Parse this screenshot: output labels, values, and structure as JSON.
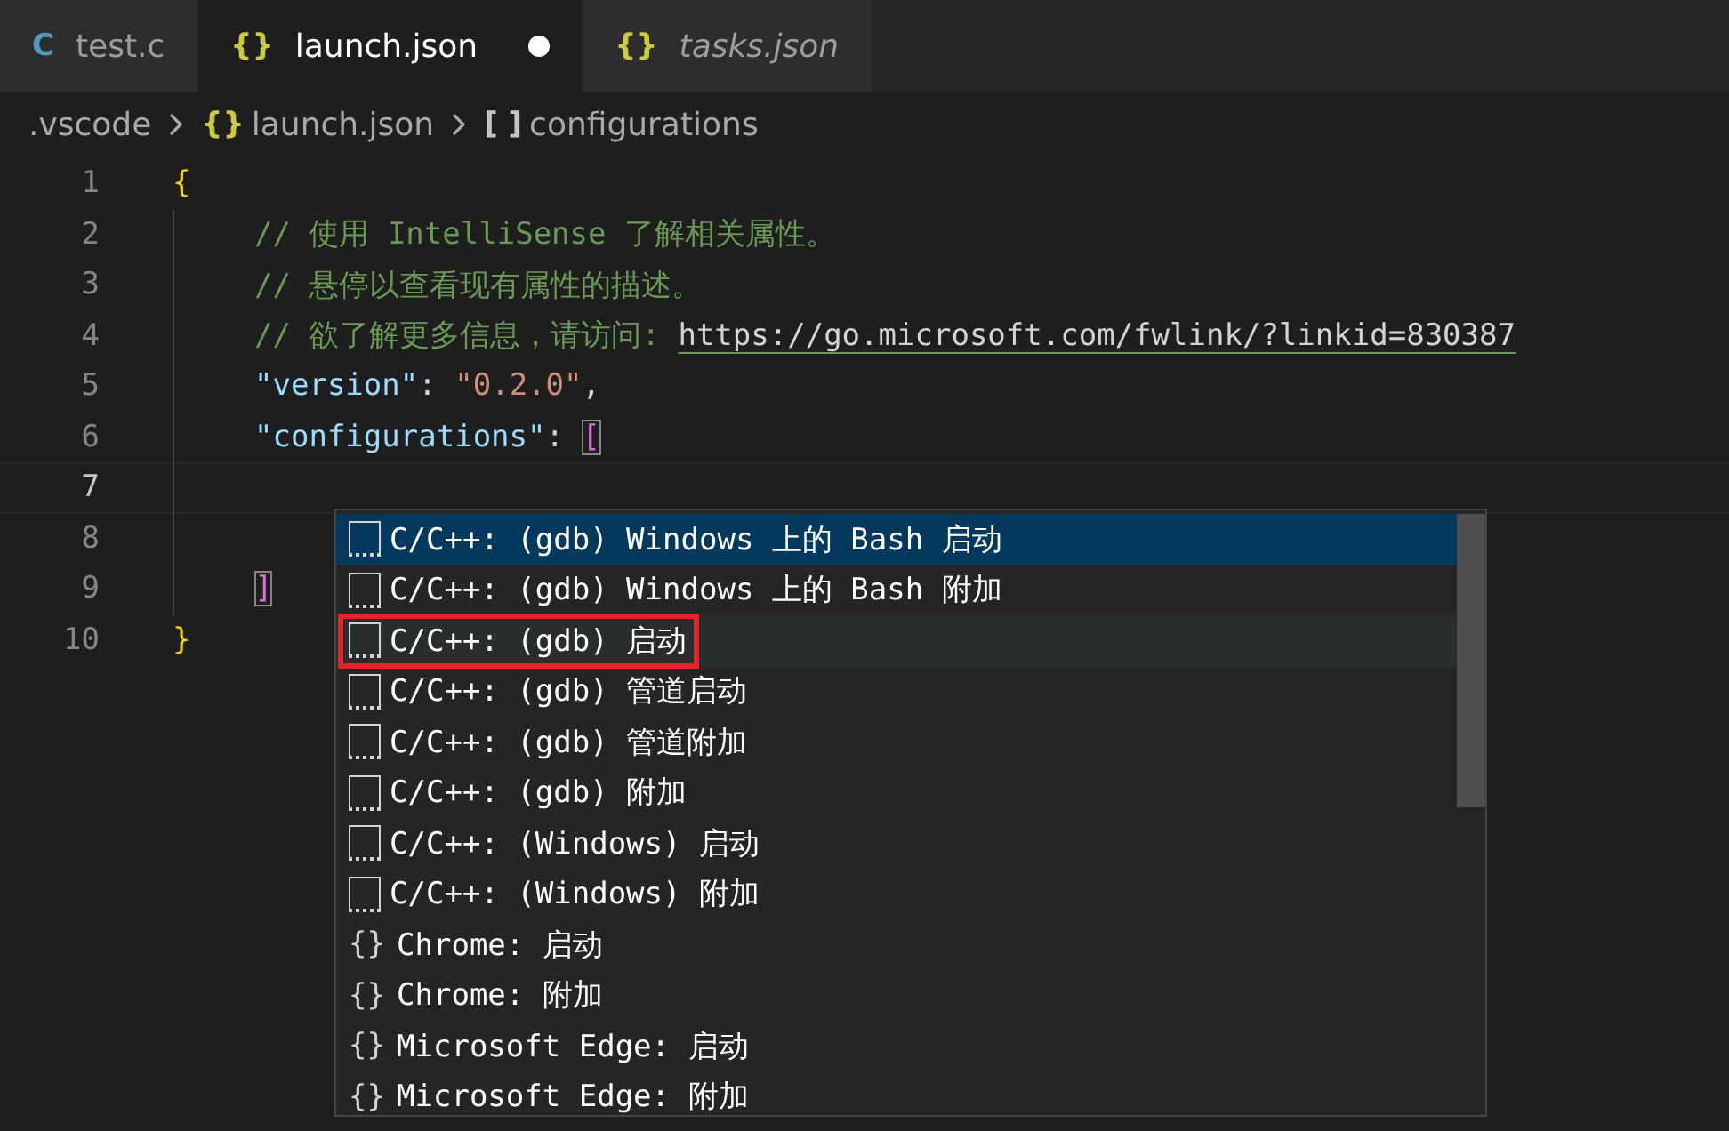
{
  "tabs": [
    {
      "label": "test.c",
      "icon": "C",
      "color": "#519aba",
      "selected": false,
      "modified": false,
      "preview": false
    },
    {
      "label": "launch.json",
      "icon": "{}",
      "color": "#cbcb41",
      "selected": true,
      "modified": true,
      "preview": false
    },
    {
      "label": "tasks.json",
      "icon": "{}",
      "color": "#cbcb41",
      "selected": false,
      "modified": false,
      "preview": true
    }
  ],
  "breadcrumbs": [
    {
      "label": ".vscode"
    },
    {
      "label": "launch.json",
      "icon": "{}",
      "color": "#cbcb41"
    },
    {
      "label": "configurations",
      "icon": "[ ]",
      "color": "#c5c5c5"
    }
  ],
  "lines": [
    {
      "number": "1",
      "tokens": [
        {
          "text": "{",
          "kind": "brace"
        }
      ],
      "children": [
        {
          "number": "2",
          "tokens": [
            {
              "text": "// 使用 IntelliSense 了解相关属性。",
              "kind": "comment"
            }
          ]
        },
        {
          "number": "3",
          "tokens": [
            {
              "text": "// 悬停以查看现有属性的描述。",
              "kind": "comment"
            }
          ]
        },
        {
          "number": "4",
          "tokens": [
            {
              "text": "// 欲了解更多信息，请访问: ",
              "kind": "comment"
            },
            {
              "text": "https://go.microsoft.com/fwlink/?linkid=830387",
              "kind": "link"
            }
          ]
        },
        {
          "number": "5",
          "tokens": [
            {
              "text": "\"version\"",
              "kind": "key"
            },
            {
              "text": ": ",
              "kind": "punct"
            },
            {
              "text": "\"0.2.0\"",
              "kind": "string"
            },
            {
              "text": ",",
              "kind": "punct"
            }
          ]
        },
        {
          "number": "6",
          "tokens": [
            {
              "text": "\"configurations\"",
              "kind": "key"
            },
            {
              "text": ": ",
              "kind": "punct"
            },
            {
              "text": "[",
              "kind": "bracket",
              "matched": true
            }
          ]
        },
        {
          "number": "7",
          "current": true
        },
        {
          "number": "8"
        },
        {
          "number": "9",
          "tokens": [
            {
              "text": "]",
              "kind": "bracket",
              "matched": true
            }
          ]
        }
      ]
    },
    {
      "number": "10",
      "tokens": [
        {
          "text": "}",
          "kind": "brace"
        }
      ]
    }
  ],
  "suggestions": [
    {
      "label": "C/C++: (gdb) Windows 上的 Bash 启动",
      "kind": "snippet",
      "selected": true,
      "outlined": false
    },
    {
      "label": "C/C++: (gdb) Windows 上的 Bash 附加",
      "kind": "snippet",
      "selected": false,
      "outlined": false
    },
    {
      "label": "C/C++: (gdb) 启动",
      "kind": "snippet",
      "selected": false,
      "outlined": true
    },
    {
      "label": "C/C++: (gdb) 管道启动",
      "kind": "snippet",
      "selected": false,
      "outlined": false
    },
    {
      "label": "C/C++: (gdb) 管道附加",
      "kind": "snippet",
      "selected": false,
      "outlined": false
    },
    {
      "label": "C/C++: (gdb) 附加",
      "kind": "snippet",
      "selected": false,
      "outlined": false
    },
    {
      "label": "C/C++: (Windows) 启动",
      "kind": "snippet",
      "selected": false,
      "outlined": false
    },
    {
      "label": "C/C++: (Windows) 附加",
      "kind": "snippet",
      "selected": false,
      "outlined": false
    },
    {
      "label": "Chrome: 启动",
      "kind": "module",
      "icon": "{}",
      "selected": false,
      "outlined": false
    },
    {
      "label": "Chrome: 附加",
      "kind": "module",
      "icon": "{}",
      "selected": false,
      "outlined": false
    },
    {
      "label": "Microsoft Edge: 启动",
      "kind": "module",
      "icon": "{}",
      "selected": false,
      "outlined": false
    },
    {
      "label": "Microsoft Edge: 附加",
      "kind": "module",
      "icon": "{}",
      "selected": false,
      "outlined": false
    }
  ]
}
